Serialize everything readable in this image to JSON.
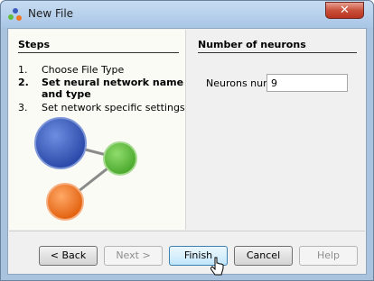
{
  "window": {
    "title": "New File",
    "close_glyph": "✕"
  },
  "steps": {
    "heading": "Steps",
    "items": [
      {
        "num": "1.",
        "label": "Choose File Type",
        "active": false
      },
      {
        "num": "2.",
        "label": "Set neural network name and type",
        "active": true
      },
      {
        "num": "3.",
        "label": "Set network specific settings",
        "active": false
      }
    ]
  },
  "illustration": {
    "nodes": [
      {
        "name": "blue-node",
        "color": "#3a5cbf"
      },
      {
        "name": "green-node",
        "color": "#5fbd3f"
      },
      {
        "name": "orange-node",
        "color": "#f07622"
      }
    ],
    "edge_color": "#8a8a8a"
  },
  "content": {
    "heading": "Number of neurons",
    "neurons_label": "Neurons num",
    "neurons_value": "9"
  },
  "buttons": {
    "back": "< Back",
    "next": "Next >",
    "finish": "Finish",
    "cancel": "Cancel",
    "help": "Help"
  },
  "colors": {
    "titlebar": "#b7d0eb",
    "accent_focus": "#3c7fb1",
    "close_red": "#c9503b"
  }
}
